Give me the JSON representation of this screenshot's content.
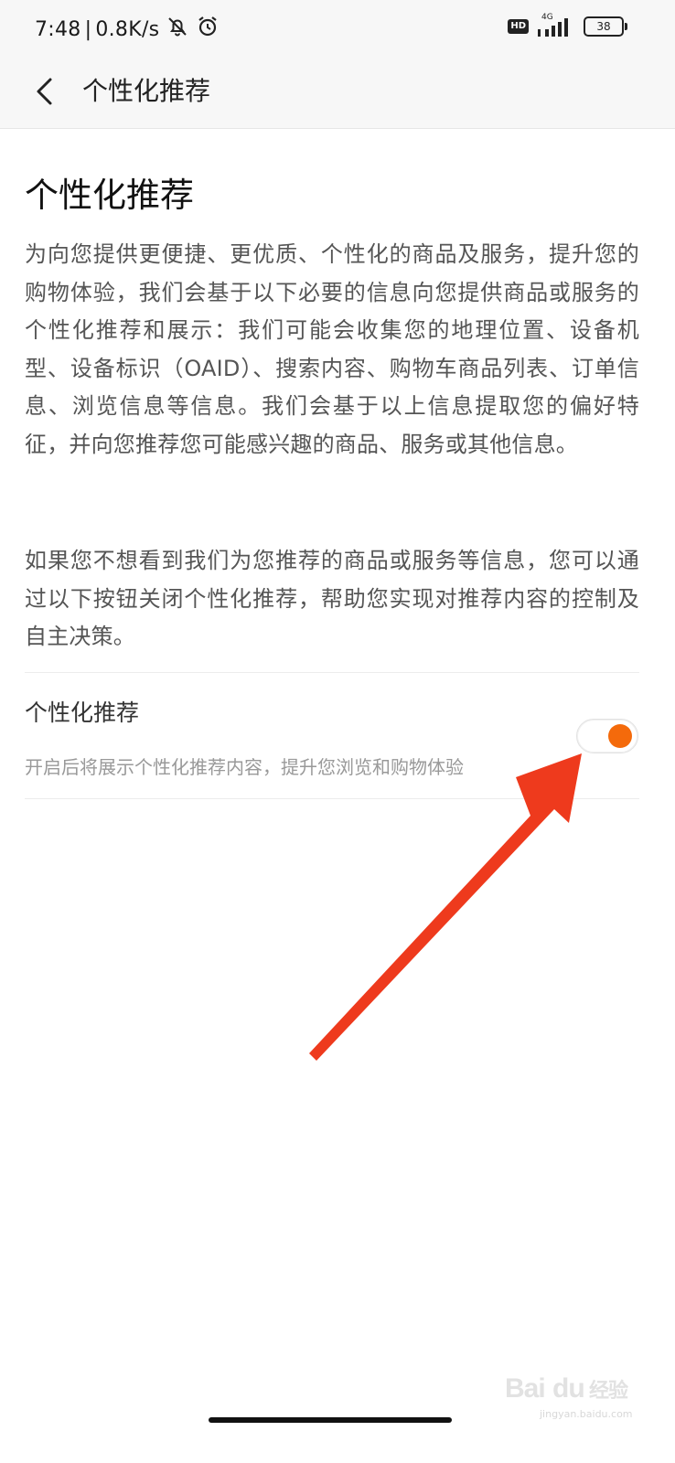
{
  "status_bar": {
    "time": "7:48",
    "separator": "|",
    "network_speed": "0.8K/s",
    "icons": [
      "mute-icon",
      "alarm-icon",
      "hd-icon",
      "signal-4g-icon",
      "battery-icon"
    ],
    "hd_label": "HD",
    "network_type": "4G",
    "battery_level": "38"
  },
  "nav": {
    "title": "个性化推荐"
  },
  "main": {
    "heading": "个性化推荐",
    "paragraph1": "为向您提供更便捷、更优质、个性化的商品及服务，提升您的购物体验，我们会基于以下必要的信息向您提供商品或服务的个性化推荐和展示：我们可能会收集您的地理位置、设备机型、设备标识（OAID）、搜索内容、购物车商品列表、订单信息、浏览信息等信息。我们会基于以上信息提取您的偏好特征，并向您推荐您可能感兴趣的商品、服务或其他信息。",
    "paragraph2": "如果您不想看到我们为您推荐的商品或服务等信息，您可以通过以下按钮关闭个性化推荐，帮助您实现对推荐内容的控制及自主决策。"
  },
  "setting": {
    "title": "个性化推荐",
    "description": "开启后将展示个性化推荐内容，提升您浏览和购物体验",
    "toggle_on": true
  },
  "colors": {
    "accent": "#f46a0b",
    "annotation_arrow": "#ee3a1d"
  },
  "watermark": {
    "text": "Bai du 经验",
    "sub": "jingyan.baidu.com"
  }
}
